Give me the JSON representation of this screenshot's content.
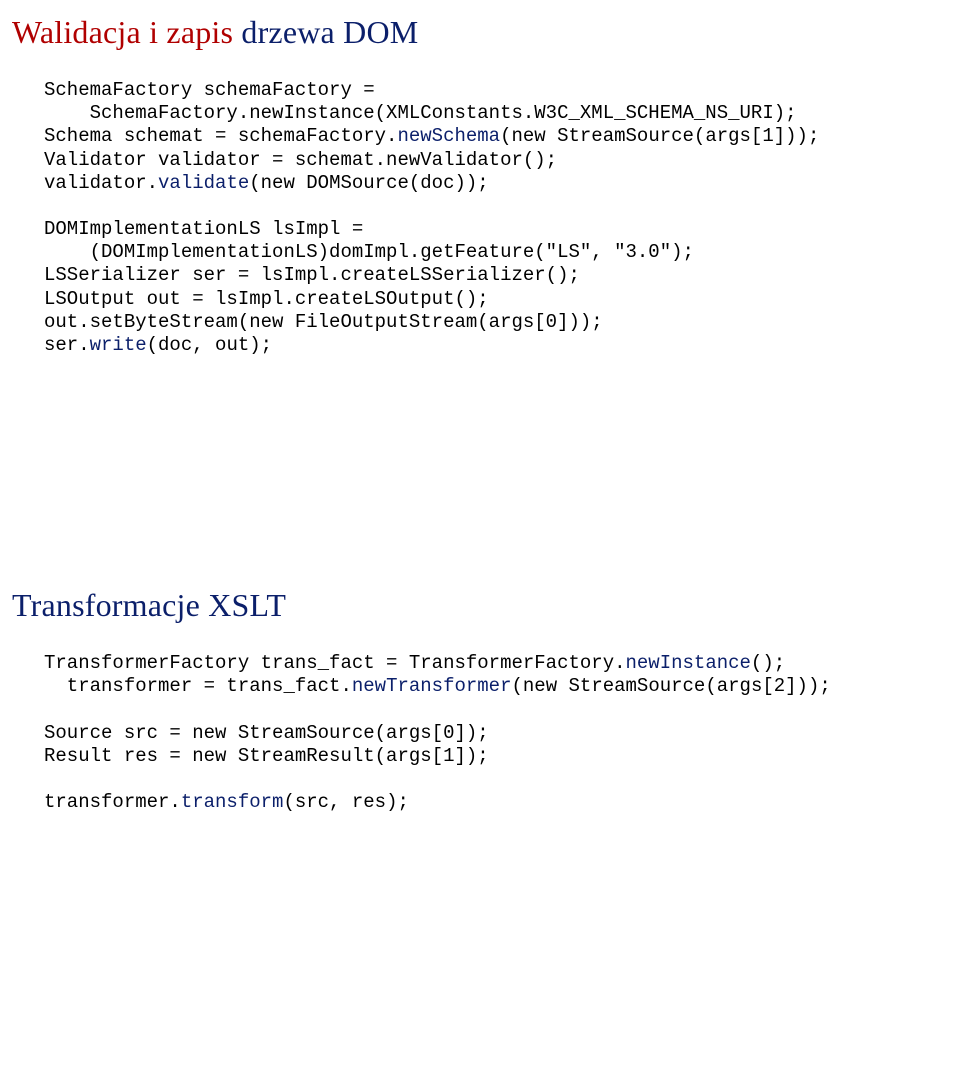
{
  "section1": {
    "heading_red": "Walidacja i zapis",
    "heading_blue": " drzewa DOM",
    "code": {
      "l1a": "SchemaFactory schemaFactory = ",
      "l2a": "    SchemaFactory.newInstance(XMLConstants.W3C_XML_SCHEMA_NS_URI);",
      "l3a": "Schema schemat = schemaFactory.",
      "l3b": "newSchema",
      "l3c": "(new StreamSource(args[1]));",
      "l4a": "Validator validator = schemat.newValidator();",
      "l5a": "validator.",
      "l5b": "validate",
      "l5c": "(new DOMSource(doc));",
      "l6": "",
      "l7a": "DOMImplementationLS lsImpl = ",
      "l8a": "    (DOMImplementationLS)domImpl.getFeature(\"LS\", \"3.0\");",
      "l9a": "LSSerializer ser = lsImpl.createLSSerializer();",
      "l10a": "LSOutput out = lsImpl.createLSOutput();",
      "l11a": "out.setByteStream(new FileOutputStream(args[0]));",
      "l12a": "ser.",
      "l12b": "write",
      "l12c": "(doc, out);"
    }
  },
  "section2": {
    "heading": "Transformacje XSLT",
    "code": {
      "l1a": "TransformerFactory trans_fact = TransformerFactory.",
      "l1b": "newInstance",
      "l1c": "();",
      "l2a": "  transformer = trans_fact.",
      "l2b": "newTransformer",
      "l2c": "(new StreamSource(args[2]));",
      "l3": "",
      "l4a": "Source src = new StreamSource(args[0]);",
      "l5a": "Result res = new StreamResult(args[1]);",
      "l6": "",
      "l7a": "transformer.",
      "l7b": "transform",
      "l7c": "(src, res);"
    }
  }
}
